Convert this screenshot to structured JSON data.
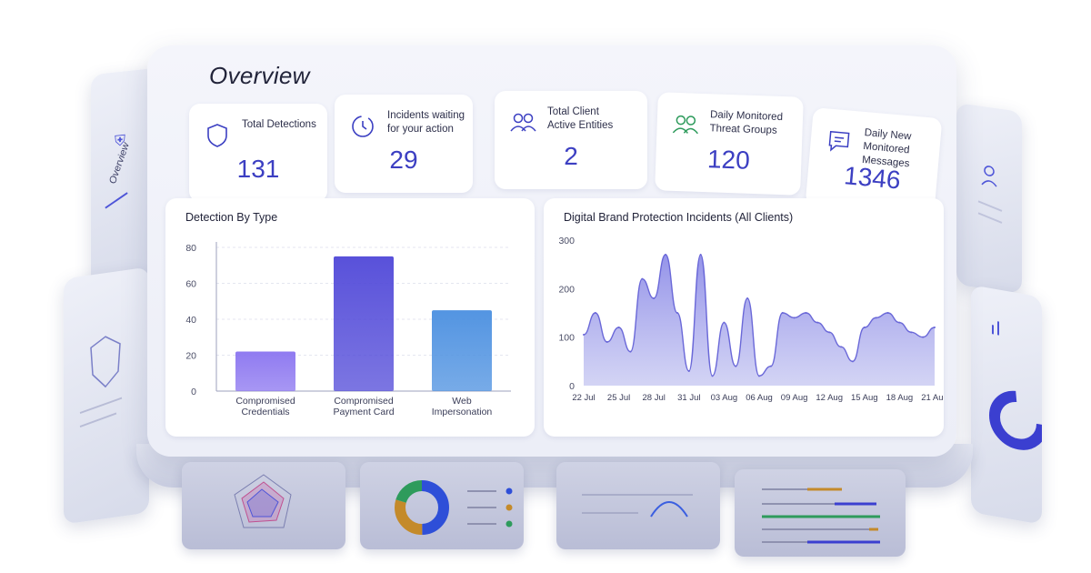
{
  "title": "Overview",
  "side_panel": {
    "label": "Overview"
  },
  "stats": [
    {
      "label": "Total Detections",
      "value": "131",
      "icon": "shield-icon"
    },
    {
      "label": "Incidents waiting for your action",
      "value": "29",
      "icon": "clock-icon"
    },
    {
      "label": "Total Client Active Entities",
      "value": "2",
      "icon": "users-icon"
    },
    {
      "label": "Daily Monitored Threat Groups",
      "value": "120",
      "icon": "group-icon"
    },
    {
      "label": "Daily New Monitored Messages",
      "value": "1346",
      "icon": "message-icon"
    }
  ],
  "colors": {
    "accent": "#3c3fc2",
    "bar1": "#8a74f0",
    "bar2": "#5048d8",
    "bar3": "#4a8fe0",
    "area": "#8f8ee8",
    "green": "#2e9b5c"
  },
  "chart_data": [
    {
      "type": "bar",
      "title": "Detection By Type",
      "categories": [
        "Compromised Credentials",
        "Compromised Payment Card",
        "Web Impersonation"
      ],
      "category_lines": [
        [
          "Compromised",
          "Credentials"
        ],
        [
          "Compromised",
          "Payment Card"
        ],
        [
          "Web",
          "Impersonation"
        ]
      ],
      "values": [
        22,
        75,
        45
      ],
      "ylim": [
        0,
        80
      ],
      "yticks": [
        0,
        20,
        40,
        60,
        80
      ],
      "grid": true
    },
    {
      "type": "area",
      "title": "Digital Brand Protection Incidents (All Clients)",
      "x": [
        "22 Jul",
        "23 Jul",
        "24 Jul",
        "25 Jul",
        "26 Jul",
        "27 Jul",
        "28 Jul",
        "29 Jul",
        "30 Jul",
        "31 Jul",
        "01 Aug",
        "02 Aug",
        "03 Aug",
        "04 Aug",
        "05 Aug",
        "06 Aug",
        "07 Aug",
        "08 Aug",
        "09 Aug",
        "10 Aug",
        "11 Aug",
        "12 Aug",
        "13 Aug",
        "14 Aug",
        "15 Aug",
        "16 Aug",
        "17 Aug",
        "18 Aug",
        "19 Aug",
        "20 Aug",
        "21 Aug"
      ],
      "xticks": [
        "22 Jul",
        "25 Jul",
        "28 Jul",
        "31 Jul",
        "03 Aug",
        "06 Aug",
        "09 Aug",
        "12 Aug",
        "15 Aug",
        "18 Aug",
        "21 Aug"
      ],
      "values": [
        105,
        150,
        90,
        120,
        70,
        220,
        180,
        270,
        150,
        30,
        270,
        20,
        130,
        40,
        180,
        20,
        40,
        150,
        140,
        150,
        130,
        110,
        80,
        50,
        120,
        140,
        150,
        130,
        110,
        100,
        120
      ],
      "ylim": [
        0,
        300
      ],
      "yticks": [
        0,
        100,
        200,
        300
      ],
      "grid": false
    }
  ]
}
